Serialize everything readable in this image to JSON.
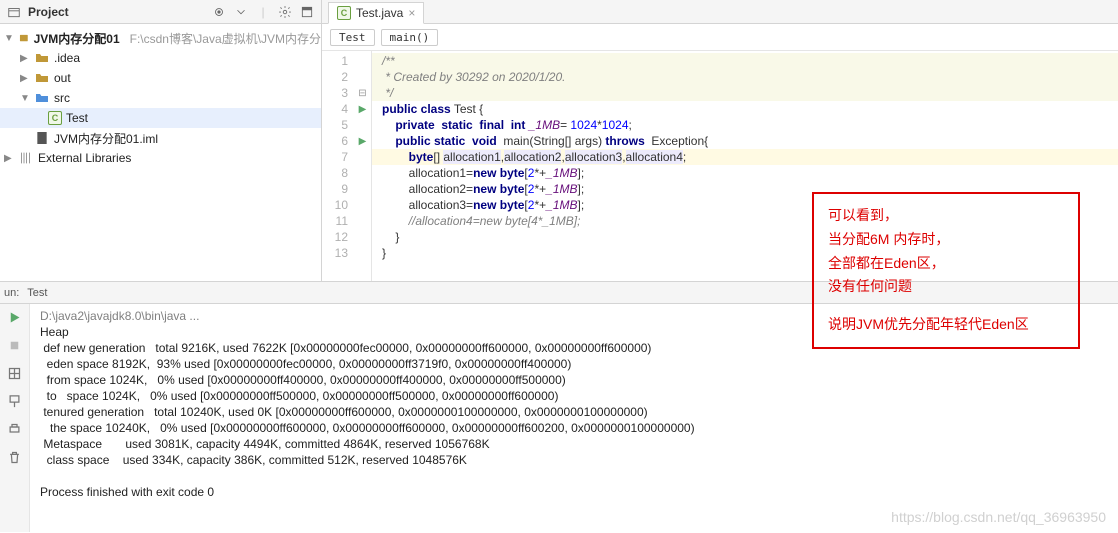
{
  "project": {
    "title": "Project",
    "root": {
      "name": "JVM内存分配01",
      "hint": "F:\\csdn博客\\Java虚拟机\\JVM内存分"
    },
    "idea": ".idea",
    "out": "out",
    "src": "src",
    "test": "Test",
    "iml": "JVM内存分配01.iml",
    "ext_lib": "External Libraries"
  },
  "editor": {
    "tab_name": "Test.java",
    "crumb_class": "Test",
    "crumb_method": "main()",
    "lines": [
      "/**",
      " * Created by 30292 on 2020/1/20.",
      " */",
      "public class Test {",
      "    private  static  final  int _1MB= 1024*1024;",
      "    public static  void  main(String[] args) throws  Exception{",
      "        byte[] allocation1,allocation2,allocation3,allocation4;",
      "        allocation1=new byte[2*+_1MB];",
      "        allocation2=new byte[2*+_1MB];",
      "        allocation3=new byte[2*+_1MB];",
      "        //allocation4=new byte[4*_1MB];",
      "    }",
      "}"
    ]
  },
  "annotation": {
    "l1": "可以看到，",
    "l2": "当分配6M 内存时，",
    "l3": "全部都在Eden区，",
    "l4": "没有任何问题",
    "l5": "说明JVM优先分配年轻代Eden区"
  },
  "run": {
    "tab1": "un:",
    "tab2": "Test",
    "console_path": "D:\\java2\\javajdk8.0\\bin\\java ...",
    "console_lines": [
      "Heap",
      " def new generation   total 9216K, used 7622K [0x00000000fec00000, 0x00000000ff600000, 0x00000000ff600000)",
      "  eden space 8192K,  93% used [0x00000000fec00000, 0x00000000ff3719f0, 0x00000000ff400000)",
      "  from space 1024K,   0% used [0x00000000ff400000, 0x00000000ff400000, 0x00000000ff500000)",
      "  to   space 1024K,   0% used [0x00000000ff500000, 0x00000000ff500000, 0x00000000ff600000)",
      " tenured generation   total 10240K, used 0K [0x00000000ff600000, 0x0000000100000000, 0x0000000100000000)",
      "   the space 10240K,   0% used [0x00000000ff600000, 0x00000000ff600000, 0x00000000ff600200, 0x0000000100000000)",
      " Metaspace       used 3081K, capacity 4494K, committed 4864K, reserved 1056768K",
      "  class space    used 334K, capacity 386K, committed 512K, reserved 1048576K",
      "",
      "Process finished with exit code 0"
    ]
  },
  "watermark": "https://blog.csdn.net/qq_36963950"
}
